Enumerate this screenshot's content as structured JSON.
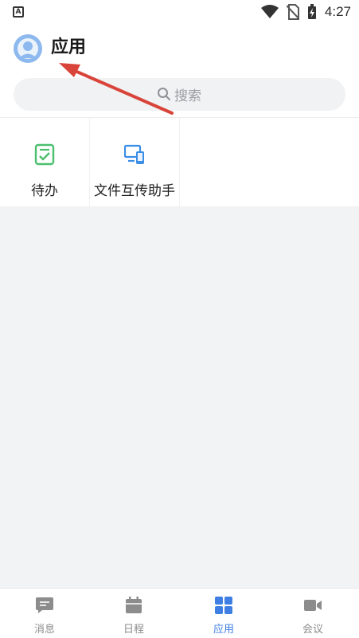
{
  "status_bar": {
    "time": "4:27"
  },
  "header": {
    "title": "应用"
  },
  "search": {
    "placeholder": "搜索"
  },
  "apps": [
    {
      "label": "待办",
      "icon": "todo-icon",
      "color": "#4cbf6f"
    },
    {
      "label": "文件互传助手",
      "icon": "file-transfer-icon",
      "color": "#3a8ee6"
    }
  ],
  "tabs": [
    {
      "label": "消息",
      "icon": "chat-bubble-icon",
      "active": false
    },
    {
      "label": "日程",
      "icon": "calendar-icon",
      "active": false
    },
    {
      "label": "应用",
      "icon": "apps-grid-icon",
      "active": true
    },
    {
      "label": "会议",
      "icon": "video-camera-icon",
      "active": false
    }
  ],
  "colors": {
    "accent": "#3f7fe3",
    "inactive": "#8c8c8c",
    "annotation_arrow": "#d9443a"
  }
}
